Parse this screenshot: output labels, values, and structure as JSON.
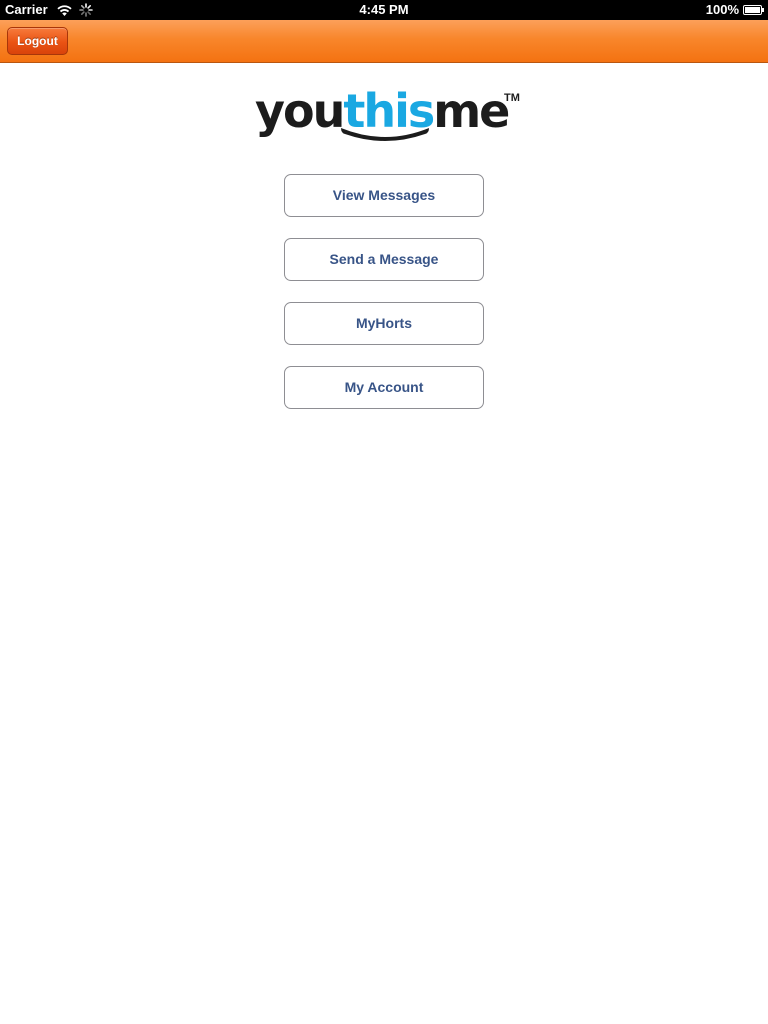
{
  "status_bar": {
    "carrier": "Carrier",
    "time": "4:45 PM",
    "battery": "100%"
  },
  "nav_bar": {
    "logout_label": "Logout",
    "accent_color": "#f47211"
  },
  "logo": {
    "part_you": "you",
    "part_this": "this",
    "part_me": "me",
    "trademark": "TM",
    "this_color": "#1aa8e2"
  },
  "menu": {
    "buttons": [
      {
        "label": "View Messages"
      },
      {
        "label": "Send a Message"
      },
      {
        "label": "MyHorts"
      },
      {
        "label": "My Account"
      }
    ],
    "text_color": "#385487"
  },
  "icons": [
    "wifi-icon",
    "activity-spinner-icon",
    "battery-icon"
  ]
}
